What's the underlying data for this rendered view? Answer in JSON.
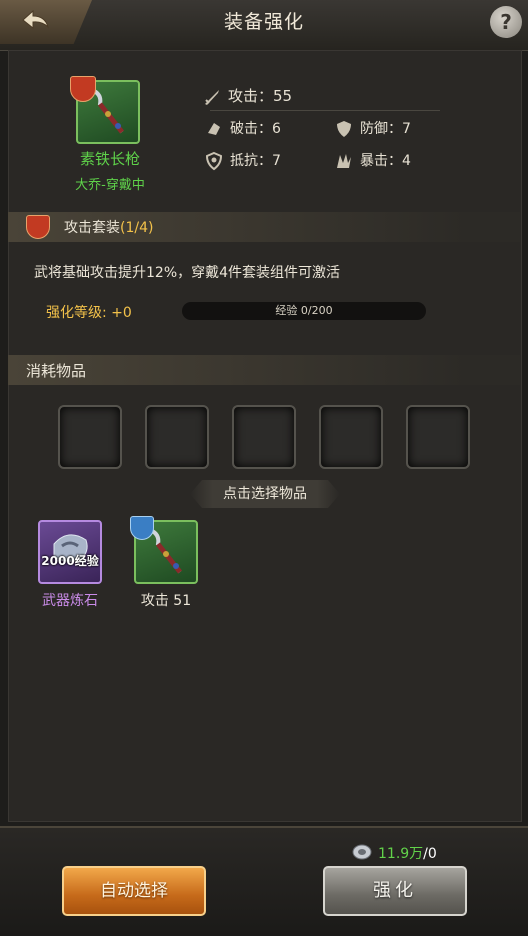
{
  "header": {
    "title": "装备强化",
    "back_icon": "back-arrow-icon",
    "help_label": "?"
  },
  "equipment": {
    "name": "素铁长枪",
    "owner": "大乔-穿戴中",
    "badge_icon": "sword-badge-icon",
    "stats": {
      "attack": "攻击：55",
      "pierce": "破击：6",
      "defense": "防御：7",
      "resist": "抵抗：7",
      "crit": "暴击：4"
    }
  },
  "set_bonus": {
    "title": "攻击套装",
    "progress": "(1/4)",
    "description": "武将基础攻击提升12%，穿戴4件套装组件可激活",
    "level_label": "强化等级: +0",
    "exp_label": "经验 0/200",
    "exp_fraction": 0
  },
  "consume": {
    "title": "消耗物品",
    "hint": "点击选择物品",
    "slots": 5
  },
  "items": [
    {
      "name": "武器炼石",
      "overlay": "2000经验",
      "icon": "weapon-refining-stone-icon"
    },
    {
      "name": "攻击 51",
      "icon": "spear-icon"
    }
  ],
  "footer": {
    "currency_amount": "11.9万",
    "currency_cost": "/0",
    "currency_icon": "silver-coin-icon",
    "auto_select_label": "自动选择",
    "enhance_label": "强化"
  },
  "colors": {
    "gold": "#f3c24a",
    "green": "#5fd24a",
    "purple": "#c98be8"
  }
}
